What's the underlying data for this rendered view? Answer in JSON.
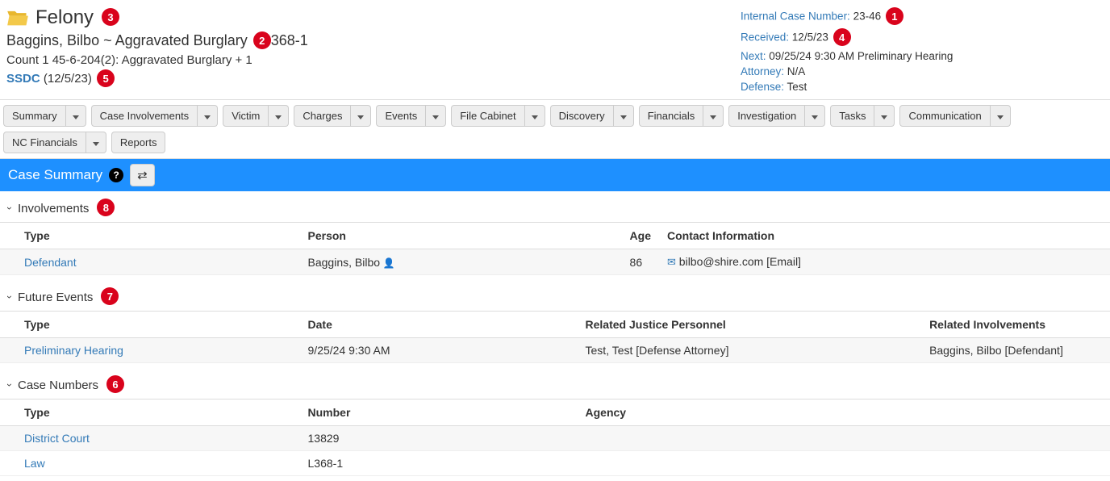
{
  "annotations": {
    "a1": "1",
    "a2": "2",
    "a3": "3",
    "a4": "4",
    "a5": "5",
    "a6": "6",
    "a7": "7",
    "a8": "8"
  },
  "header": {
    "case_type": "Felony",
    "case_line_name": "Baggins, Bilbo",
    "case_line_sep": " ~ ",
    "case_line_charge": "Aggravated Burglary ",
    "case_line_suffix": "368-1",
    "count_line": "Count 1 45-6-204(2): Aggravated Burglary + 1",
    "ssdc_label": "SSDC",
    "ssdc_date": " (12/5/23)"
  },
  "info": {
    "internal_label": "Internal Case Number:",
    "internal_value": " 23-46",
    "received_label": "Received:",
    "received_value": " 12/5/23",
    "next_label": "Next:",
    "next_value": " 09/25/24 9:30 AM Preliminary Hearing",
    "attorney_label": "Attorney:",
    "attorney_value": " N/A",
    "defense_label": "Defense:",
    "defense_value": " Test"
  },
  "tabs": {
    "summary": "Summary",
    "involvements": "Case Involvements",
    "victim": "Victim",
    "charges": "Charges",
    "events": "Events",
    "file": "File Cabinet",
    "discovery": "Discovery",
    "financials": "Financials",
    "investigation": "Investigation",
    "tasks": "Tasks",
    "communication": "Communication",
    "nc_financials": "NC Financials",
    "reports": "Reports"
  },
  "summary_bar": {
    "title": "Case Summary",
    "help": "?",
    "refresh": "⇄"
  },
  "sections": {
    "involvements": "Involvements",
    "future_events": "Future Events",
    "case_numbers": "Case Numbers"
  },
  "inv_headers": {
    "type": "Type",
    "person": "Person",
    "age": "Age",
    "contact": "Contact Information"
  },
  "inv_row": {
    "type": "Defendant",
    "person": "Baggins, Bilbo",
    "age": "86",
    "contact": " bilbo@shire.com [Email]"
  },
  "ev_headers": {
    "type": "Type",
    "date": "Date",
    "personnel": "Related Justice Personnel",
    "inv": "Related Involvements"
  },
  "ev_row": {
    "type": "Preliminary Hearing",
    "date": "9/25/24 9:30 AM",
    "personnel": "Test, Test [Defense Attorney]",
    "inv": "Baggins, Bilbo [Defendant]"
  },
  "cn_headers": {
    "type": "Type",
    "number": "Number",
    "agency": "Agency"
  },
  "cn_rows": [
    {
      "type": "District Court",
      "number": "13829",
      "agency": ""
    },
    {
      "type": "Law",
      "number": "L368-1",
      "agency": ""
    }
  ]
}
